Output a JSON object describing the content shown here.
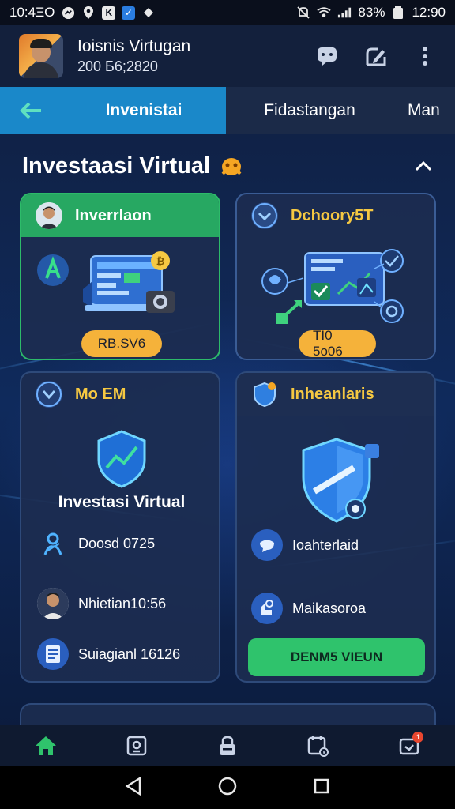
{
  "status_bar": {
    "time_left": "10:4ΞΟ",
    "battery": "83%",
    "time_right": "12:90"
  },
  "header": {
    "title": "Ioisnis Virtugan",
    "subtitle": "200 Б6;2820"
  },
  "tabs": [
    {
      "label": "Invenistai",
      "active": true
    },
    {
      "label": "Fidastangan",
      "active": false
    },
    {
      "label": "Man",
      "active": false
    }
  ],
  "section": {
    "title": "Investaasi Virtual"
  },
  "cards": {
    "c1": {
      "title": "Inverrlaon",
      "pill": "RB.SV6"
    },
    "c2": {
      "title": "Dchoory5T",
      "pill": "TI0 5o06"
    },
    "c3": {
      "title": "Mo EM",
      "subtitle": "Investasi Virtual",
      "rows": [
        {
          "text": "Doosd 0725",
          "icon": "people-icon"
        },
        {
          "text": "Nhietian10:56",
          "icon": "user-icon"
        },
        {
          "text": "Suiagianl 16126",
          "icon": "document-icon"
        }
      ]
    },
    "c4": {
      "title": "Inheanlaris",
      "rows": [
        {
          "text": "Ioahterlaid",
          "icon": "chat-icon"
        },
        {
          "text": "Maikasoroa",
          "icon": "hand-icon"
        }
      ],
      "cta": "DENM5 VIEUN"
    }
  },
  "bottom_nav": [
    {
      "icon": "home-icon",
      "active": true
    },
    {
      "icon": "wallet-icon",
      "active": false
    },
    {
      "icon": "lock-icon",
      "active": false
    },
    {
      "icon": "calendar-icon",
      "active": false
    },
    {
      "icon": "bell-icon",
      "active": false,
      "badge": "1"
    }
  ],
  "colors": {
    "accent_blue": "#1a88c9",
    "accent_green": "#2fc36c",
    "accent_gold": "#f5c842",
    "pill": "#f5b23a"
  }
}
